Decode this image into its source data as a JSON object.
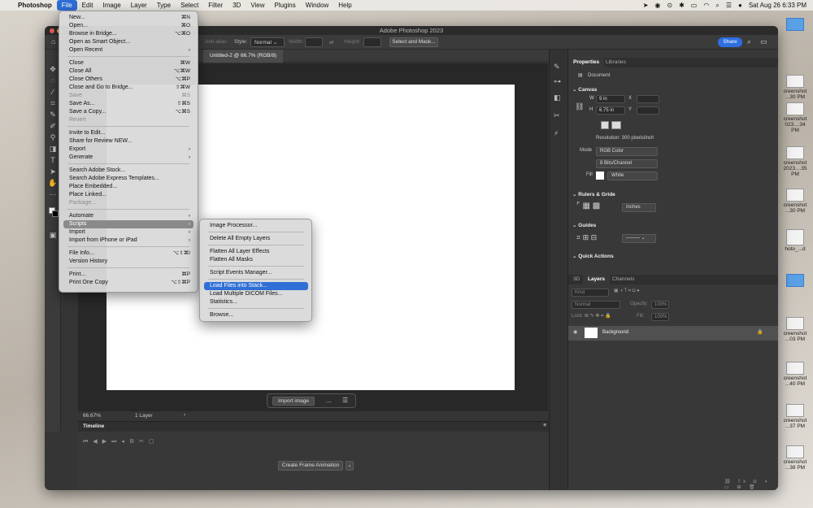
{
  "menubar": {
    "app": "Photoshop",
    "items": [
      "File",
      "Edit",
      "Image",
      "Layer",
      "Type",
      "Select",
      "Filter",
      "3D",
      "View",
      "Plugins",
      "Window",
      "Help"
    ],
    "datetime": "Sat Aug 26  6:33 PM"
  },
  "window": {
    "title": "Adobe Photoshop 2023"
  },
  "options": {
    "antialias": "Anti-alias",
    "style_label": "Style:",
    "style_value": "Normal",
    "width_label": "Width:",
    "height_label": "Height:",
    "select_mask": "Select and Mask...",
    "share": "Share"
  },
  "document": {
    "tab": "Untitled-2 @ 66.7% (RGB/8)",
    "zoom": "66.67%",
    "layers_count": "1 Layer"
  },
  "contextbar": {
    "import": "Import image",
    "more": "..."
  },
  "timeline": {
    "title": "Timeline",
    "create": "Create Frame Animation"
  },
  "properties": {
    "tab1": "Properties",
    "tab2": "Libraries",
    "doc": "Document",
    "canvas": "Canvas",
    "w_label": "W",
    "w_value": "9 in",
    "h_label": "H",
    "h_value": "6.75 in",
    "x_label": "X",
    "y_label": "Y",
    "resolution": "Resolution: 300 pixels/inch",
    "mode_label": "Mode",
    "mode_value": "RGB Color",
    "bits_value": "8 Bits/Channel",
    "fill_label": "Fill",
    "fill_value": "White",
    "rulers": "Rulers & Gride",
    "units": "Inches",
    "guides": "Guides",
    "quick": "Quick Actions"
  },
  "layers": {
    "tab1": "3D",
    "tab2": "Layers",
    "tab3": "Channels",
    "kind": "Kind",
    "blend": "Normal",
    "opacity": "Opacity:",
    "opacity_val": "100%",
    "lock": "Lock:",
    "fill": "Fill:",
    "fill_val": "100%",
    "layer_name": "Background"
  },
  "file_menu": [
    {
      "label": "New...",
      "sc": "⌘N"
    },
    {
      "label": "Open...",
      "sc": "⌘O"
    },
    {
      "label": "Browse in Bridge...",
      "sc": "⌥⌘O"
    },
    {
      "label": "Open as Smart Object...",
      "sc": ""
    },
    {
      "label": "Open Recent",
      "sc": "›"
    },
    {
      "label": "Close",
      "sc": "⌘W"
    },
    {
      "label": "Close All",
      "sc": "⌥⌘W"
    },
    {
      "label": "Close Others",
      "sc": "⌥⌘P"
    },
    {
      "label": "Close and Go to Bridge...",
      "sc": "⇧⌘W"
    },
    {
      "label": "Save",
      "sc": "⌘S"
    },
    {
      "label": "Save As...",
      "sc": "⇧⌘S"
    },
    {
      "label": "Save a Copy...",
      "sc": "⌥⌘S"
    },
    {
      "label": "Revert",
      "sc": ""
    },
    {
      "label": "Invite to Edit...",
      "sc": ""
    },
    {
      "label": "Share for Review NEW...",
      "sc": ""
    },
    {
      "label": "Export",
      "sc": "›"
    },
    {
      "label": "Generate",
      "sc": "›"
    },
    {
      "label": "Search Adobe Stock...",
      "sc": ""
    },
    {
      "label": "Search Adobe Express Templates...",
      "sc": ""
    },
    {
      "label": "Place Embedded...",
      "sc": ""
    },
    {
      "label": "Place Linked...",
      "sc": ""
    },
    {
      "label": "Package...",
      "sc": ""
    },
    {
      "label": "Automate",
      "sc": "›"
    },
    {
      "label": "Scripts",
      "sc": "›"
    },
    {
      "label": "Import",
      "sc": "›"
    },
    {
      "label": "Import from iPhone or iPad",
      "sc": "›"
    },
    {
      "label": "File Info...",
      "sc": "⌥⇧⌘I"
    },
    {
      "label": "Version History",
      "sc": ""
    },
    {
      "label": "Print...",
      "sc": "⌘P"
    },
    {
      "label": "Print One Copy",
      "sc": "⌥⇧⌘P"
    }
  ],
  "scripts_menu": [
    {
      "label": "Image Processor..."
    },
    {
      "label": "Delete All Empty Layers"
    },
    {
      "label": "Flatten All Layer Effects"
    },
    {
      "label": "Flatten All Masks"
    },
    {
      "label": "Script Events Manager..."
    },
    {
      "label": "Load Files into Stack..."
    },
    {
      "label": "Load Multiple DICOM Files..."
    },
    {
      "label": "Statistics..."
    },
    {
      "label": "Browse..."
    }
  ],
  "desktop": [
    "creenshot ...30 PM",
    "creenshot 023....34 PM",
    "creenshot 2023....35 PM",
    "creenshot ...30 PM",
    "hoto_...d",
    "creenshot ...03 PM",
    "creenshot ...40 PM",
    "creenshot ...37 PM",
    "creenshot ...38 PM"
  ]
}
